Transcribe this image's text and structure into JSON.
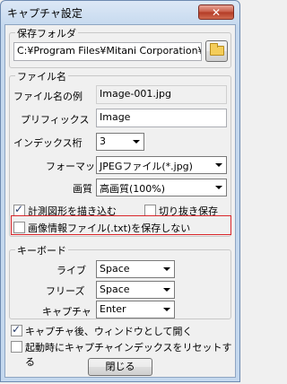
{
  "window": {
    "title": "キャプチャ設定",
    "close_glyph": "✕"
  },
  "save_folder": {
    "group_label": "保存フォルダ",
    "path": "C:¥Program Files¥Mitani Corporation¥Wi",
    "browse_icon": "folder-icon"
  },
  "filename": {
    "group_label": "ファイル名",
    "example_label": "ファイル名の例",
    "example_value": "Image-001.jpg",
    "prefix_label": "プリフィックス",
    "prefix_value": "Image",
    "index_digits_label": "インデックス桁",
    "index_digits_value": "3",
    "format_label": "フォーマット",
    "format_value": "JPEGファイル(*.jpg)",
    "quality_label": "画質",
    "quality_value": "高画質(100%)",
    "draw_measure_label": "計測図形を描き込む",
    "draw_measure_checked": true,
    "crop_save_label": "切り抜き保存",
    "crop_save_checked": false,
    "no_info_file_label": "画像情報ファイル(.txt)を保存しない",
    "no_info_file_checked": false
  },
  "keyboard": {
    "group_label": "キーボード",
    "live_label": "ライブ",
    "live_value": "Space",
    "freeze_label": "フリーズ",
    "freeze_value": "Space",
    "capture_label": "キャプチャ",
    "capture_value": "Enter"
  },
  "options": {
    "open_window_after_label": "キャプチャ後、ウィンドウとして開く",
    "open_window_after_checked": true,
    "reset_index_label": "起動時にキャプチャインデックスをリセットする",
    "reset_index_checked": false
  },
  "close_button_label": "閉じる",
  "colors": {
    "highlight_border": "#d9262b",
    "title_bar": "#c4d8ee"
  }
}
